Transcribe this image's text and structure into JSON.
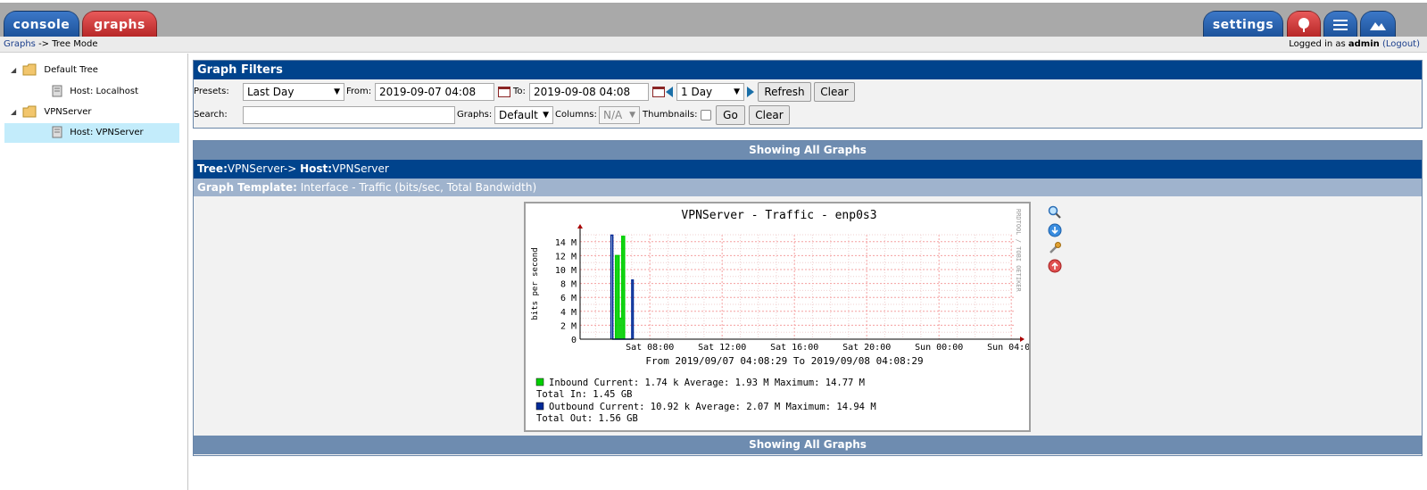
{
  "tabs": {
    "console": "console",
    "graphs": "graphs",
    "settings": "settings"
  },
  "icons": {
    "tree_tab": "tree-icon",
    "list_tab": "list-icon",
    "preview_tab": "mountain-icon"
  },
  "breadcrumb": {
    "link": "Graphs",
    "sep": " -> ",
    "current": "Tree Mode"
  },
  "login": {
    "prefix": "Logged in as ",
    "user": "admin",
    "logout": "(Logout)"
  },
  "sidebar": {
    "items": [
      {
        "label": "Default Tree",
        "type": "tree",
        "expanded": true
      },
      {
        "label": "Host: Localhost",
        "type": "host"
      },
      {
        "label": "VPNServer",
        "type": "tree",
        "expanded": true
      },
      {
        "label": "Host: VPNServer",
        "type": "host",
        "selected": true
      }
    ]
  },
  "filters": {
    "title": "Graph Filters",
    "presets_label": "Presets:",
    "preset_value": "Last Day",
    "from_label": "From:",
    "from_value": "2019-09-07 04:08",
    "to_label": "To:",
    "to_value": "2019-09-08 04:08",
    "timespan_value": "1 Day",
    "refresh": "Refresh",
    "clear": "Clear",
    "search_label": "Search:",
    "search_value": "",
    "graphs_label": "Graphs:",
    "graphs_value": "Default",
    "columns_label": "Columns:",
    "columns_value": "N/A",
    "thumbnails_label": "Thumbnails:",
    "thumbnails_checked": false,
    "go": "Go",
    "clear2": "Clear"
  },
  "graphs_section": {
    "showing_top": "Showing All Graphs",
    "showing_bottom": "Showing All Graphs",
    "tree_label": "Tree:",
    "tree_value": "VPNServer->",
    "host_label": "Host:",
    "host_value": "VPNServer",
    "template_label": "Graph Template:",
    "template_value": "Interface - Traffic (bits/sec, Total Bandwidth)"
  },
  "chart_data": {
    "type": "line",
    "title": "VPNServer - Traffic - enp0s3",
    "ylabel": "bits per second",
    "watermark": "RRDTOOL / TOBI OETIKER",
    "yticks": [
      "0",
      "2 M",
      "4 M",
      "6 M",
      "8 M",
      "10 M",
      "12 M",
      "14 M"
    ],
    "xticks": [
      "Sat 08:00",
      "Sat 12:00",
      "Sat 16:00",
      "Sat 20:00",
      "Sun 00:00",
      "Sun 04:00"
    ],
    "ylim": [
      0,
      15
    ],
    "yunit": "M bits/s",
    "xlim_hours": [
      4.14,
      28.14
    ],
    "from_to": "From 2019/09/07 04:08:29 To 2019/09/08 04:08:29",
    "series": [
      {
        "name": "Inbound",
        "color": "#00cf00",
        "points": [
          [
            6.1,
            0
          ],
          [
            6.1,
            12.0
          ],
          [
            6.3,
            12.0
          ],
          [
            6.3,
            3.0
          ],
          [
            6.45,
            3.0
          ],
          [
            6.45,
            14.77
          ],
          [
            6.6,
            14.77
          ],
          [
            6.6,
            0
          ]
        ]
      },
      {
        "name": "Outbound",
        "color": "#002a97",
        "points": [
          [
            5.85,
            0
          ],
          [
            5.85,
            14.94
          ],
          [
            5.95,
            14.94
          ],
          [
            5.95,
            0
          ],
          [
            7.0,
            0
          ],
          [
            7.0,
            8.5
          ],
          [
            7.08,
            8.5
          ],
          [
            7.08,
            0
          ]
        ]
      }
    ],
    "legend": [
      {
        "color": "#00cf00",
        "line1": "Inbound   Current:      1.74 k  Average:     1.93 M  Maximum:    14.77 M",
        "line2": "Total In:  1.45 GB"
      },
      {
        "color": "#002a97",
        "line1": "Outbound  Current:     10.92 k  Average:     2.07 M  Maximum:    14.94 M",
        "line2": "Total Out: 1.56 GB"
      }
    ]
  },
  "graph_actions": [
    "zoom-icon",
    "csv-export-icon",
    "properties-icon",
    "timespan-icon"
  ]
}
